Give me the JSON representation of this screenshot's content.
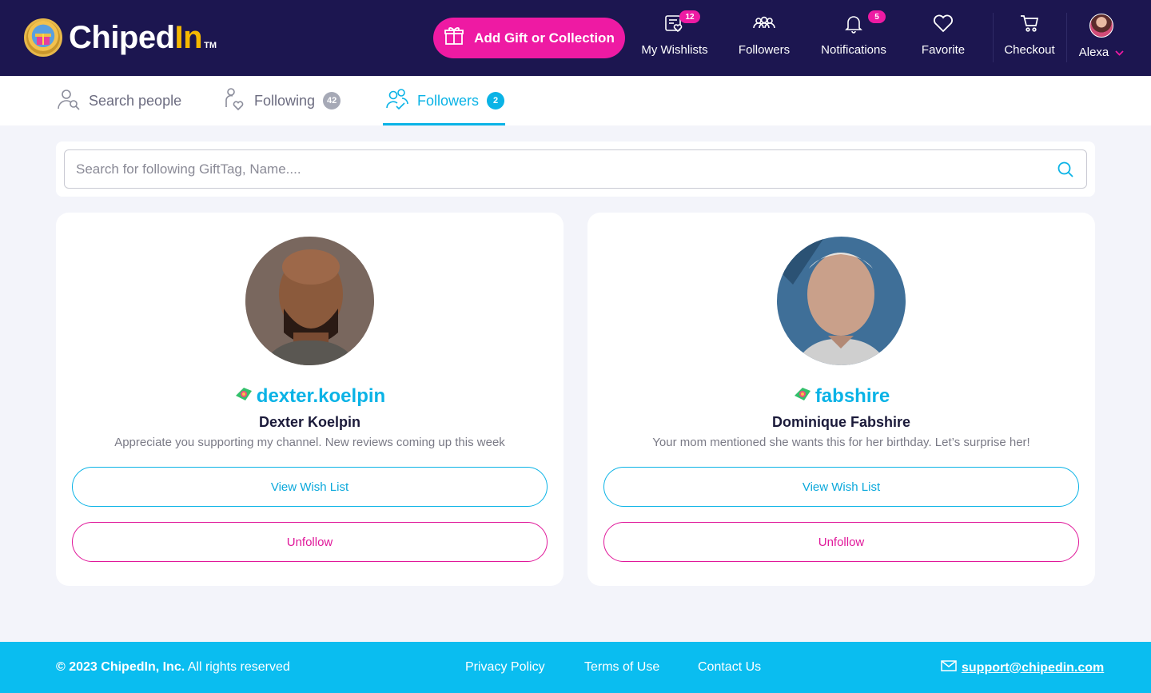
{
  "brand": {
    "name_main": "Chiped",
    "name_accent": "In",
    "trademark": "TM"
  },
  "header": {
    "add_button": "Add Gift or Collection",
    "nav": [
      {
        "label": "My Wishlists",
        "badge": "12",
        "icon": "wishlist-icon"
      },
      {
        "label": "Followers",
        "icon": "followers-icon"
      },
      {
        "label": "Notifications",
        "badge": "5",
        "icon": "bell-icon"
      },
      {
        "label": "Favorite",
        "icon": "heart-icon"
      },
      {
        "label": "Checkout",
        "icon": "cart-icon"
      }
    ],
    "user": {
      "name": "Alexa"
    }
  },
  "tabs": [
    {
      "label": "Search people",
      "icon": "search-person-icon"
    },
    {
      "label": "Following",
      "count": "42",
      "icon": "following-icon"
    },
    {
      "label": "Followers",
      "count": "2",
      "icon": "followers-icon",
      "active": true
    }
  ],
  "search": {
    "placeholder": "Search for following GiftTag, Name...."
  },
  "followers": [
    {
      "gifttag": "dexter.koelpin",
      "name": "Dexter Koelpin",
      "message": "Appreciate you supporting my channel.  New reviews coming up this week",
      "view_label": "View Wish List",
      "unfollow_label": "Unfollow"
    },
    {
      "gifttag": "fabshire",
      "name": "Dominique Fabshire",
      "message": "Your mom mentioned she wants this for her birthday.  Let’s surprise her!",
      "view_label": "View Wish List",
      "unfollow_label": "Unfollow"
    }
  ],
  "footer": {
    "copyright_bold": "© 2023 ChipedIn, Inc.",
    "copyright_rest": " All rights reserved",
    "links": [
      "Privacy Policy",
      "Terms of Use",
      "Contact Us"
    ],
    "email": "support@chipedin.com"
  },
  "colors": {
    "header_bg": "#1c1650",
    "accent_pink": "#ee1aa3",
    "accent_cyan": "#0ab3e6",
    "footer_bg": "#0abdf0"
  }
}
